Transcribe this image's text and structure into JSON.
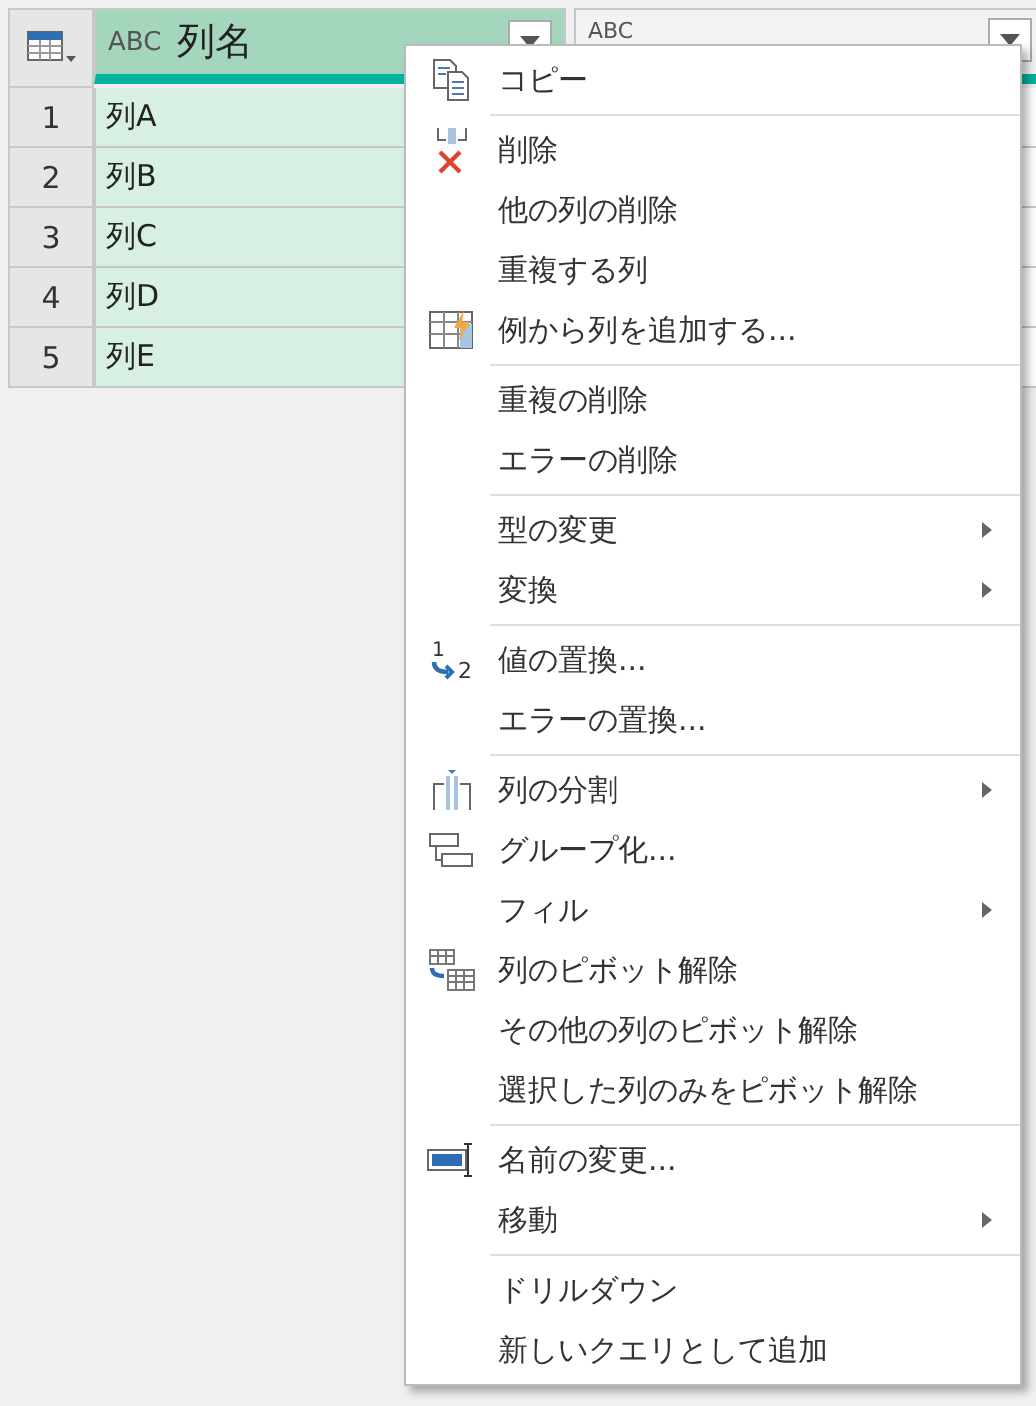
{
  "table": {
    "columns": [
      {
        "type": "ABC",
        "name": "列名",
        "selected": true
      },
      {
        "type": "ABC",
        "selected": false
      }
    ],
    "rows": [
      {
        "index": "1",
        "cells": [
          "列A",
          ""
        ]
      },
      {
        "index": "2",
        "cells": [
          "列B",
          ""
        ]
      },
      {
        "index": "3",
        "cells": [
          "列C",
          ""
        ]
      },
      {
        "index": "4",
        "cells": [
          "列D",
          ""
        ]
      },
      {
        "index": "5",
        "cells": [
          "列E",
          ""
        ]
      }
    ]
  },
  "menu": {
    "sections": [
      [
        {
          "label": "コピー",
          "kind": "copy",
          "submenu": false
        }
      ],
      [
        {
          "label": "削除",
          "kind": "delete",
          "submenu": false
        },
        {
          "label": "他の列の削除",
          "submenu": false
        },
        {
          "label": "重複する列",
          "submenu": false
        },
        {
          "label": "例から列を追加する...",
          "kind": "example",
          "submenu": false
        }
      ],
      [
        {
          "label": "重複の削除",
          "submenu": false
        },
        {
          "label": "エラーの削除",
          "submenu": false
        }
      ],
      [
        {
          "label": "型の変更",
          "submenu": true
        },
        {
          "label": "変換",
          "submenu": true
        }
      ],
      [
        {
          "label": "値の置換...",
          "kind": "replace",
          "icon_text": [
            "1",
            "2"
          ],
          "submenu": false
        },
        {
          "label": "エラーの置換...",
          "submenu": false
        }
      ],
      [
        {
          "label": "列の分割",
          "kind": "split",
          "submenu": true
        },
        {
          "label": "グループ化...",
          "kind": "group",
          "submenu": false
        },
        {
          "label": "フィル",
          "submenu": true
        },
        {
          "label": "列のピボット解除",
          "kind": "unpivot",
          "submenu": false
        },
        {
          "label": "その他の列のピボット解除",
          "submenu": false
        },
        {
          "label": "選択した列のみをピボット解除",
          "submenu": false
        }
      ],
      [
        {
          "label": "名前の変更...",
          "kind": "rename",
          "submenu": false
        },
        {
          "label": "移動",
          "submenu": true
        }
      ],
      [
        {
          "label": "ドリルダウン",
          "submenu": false
        },
        {
          "label": "新しいクエリとして追加",
          "submenu": false
        }
      ]
    ]
  }
}
